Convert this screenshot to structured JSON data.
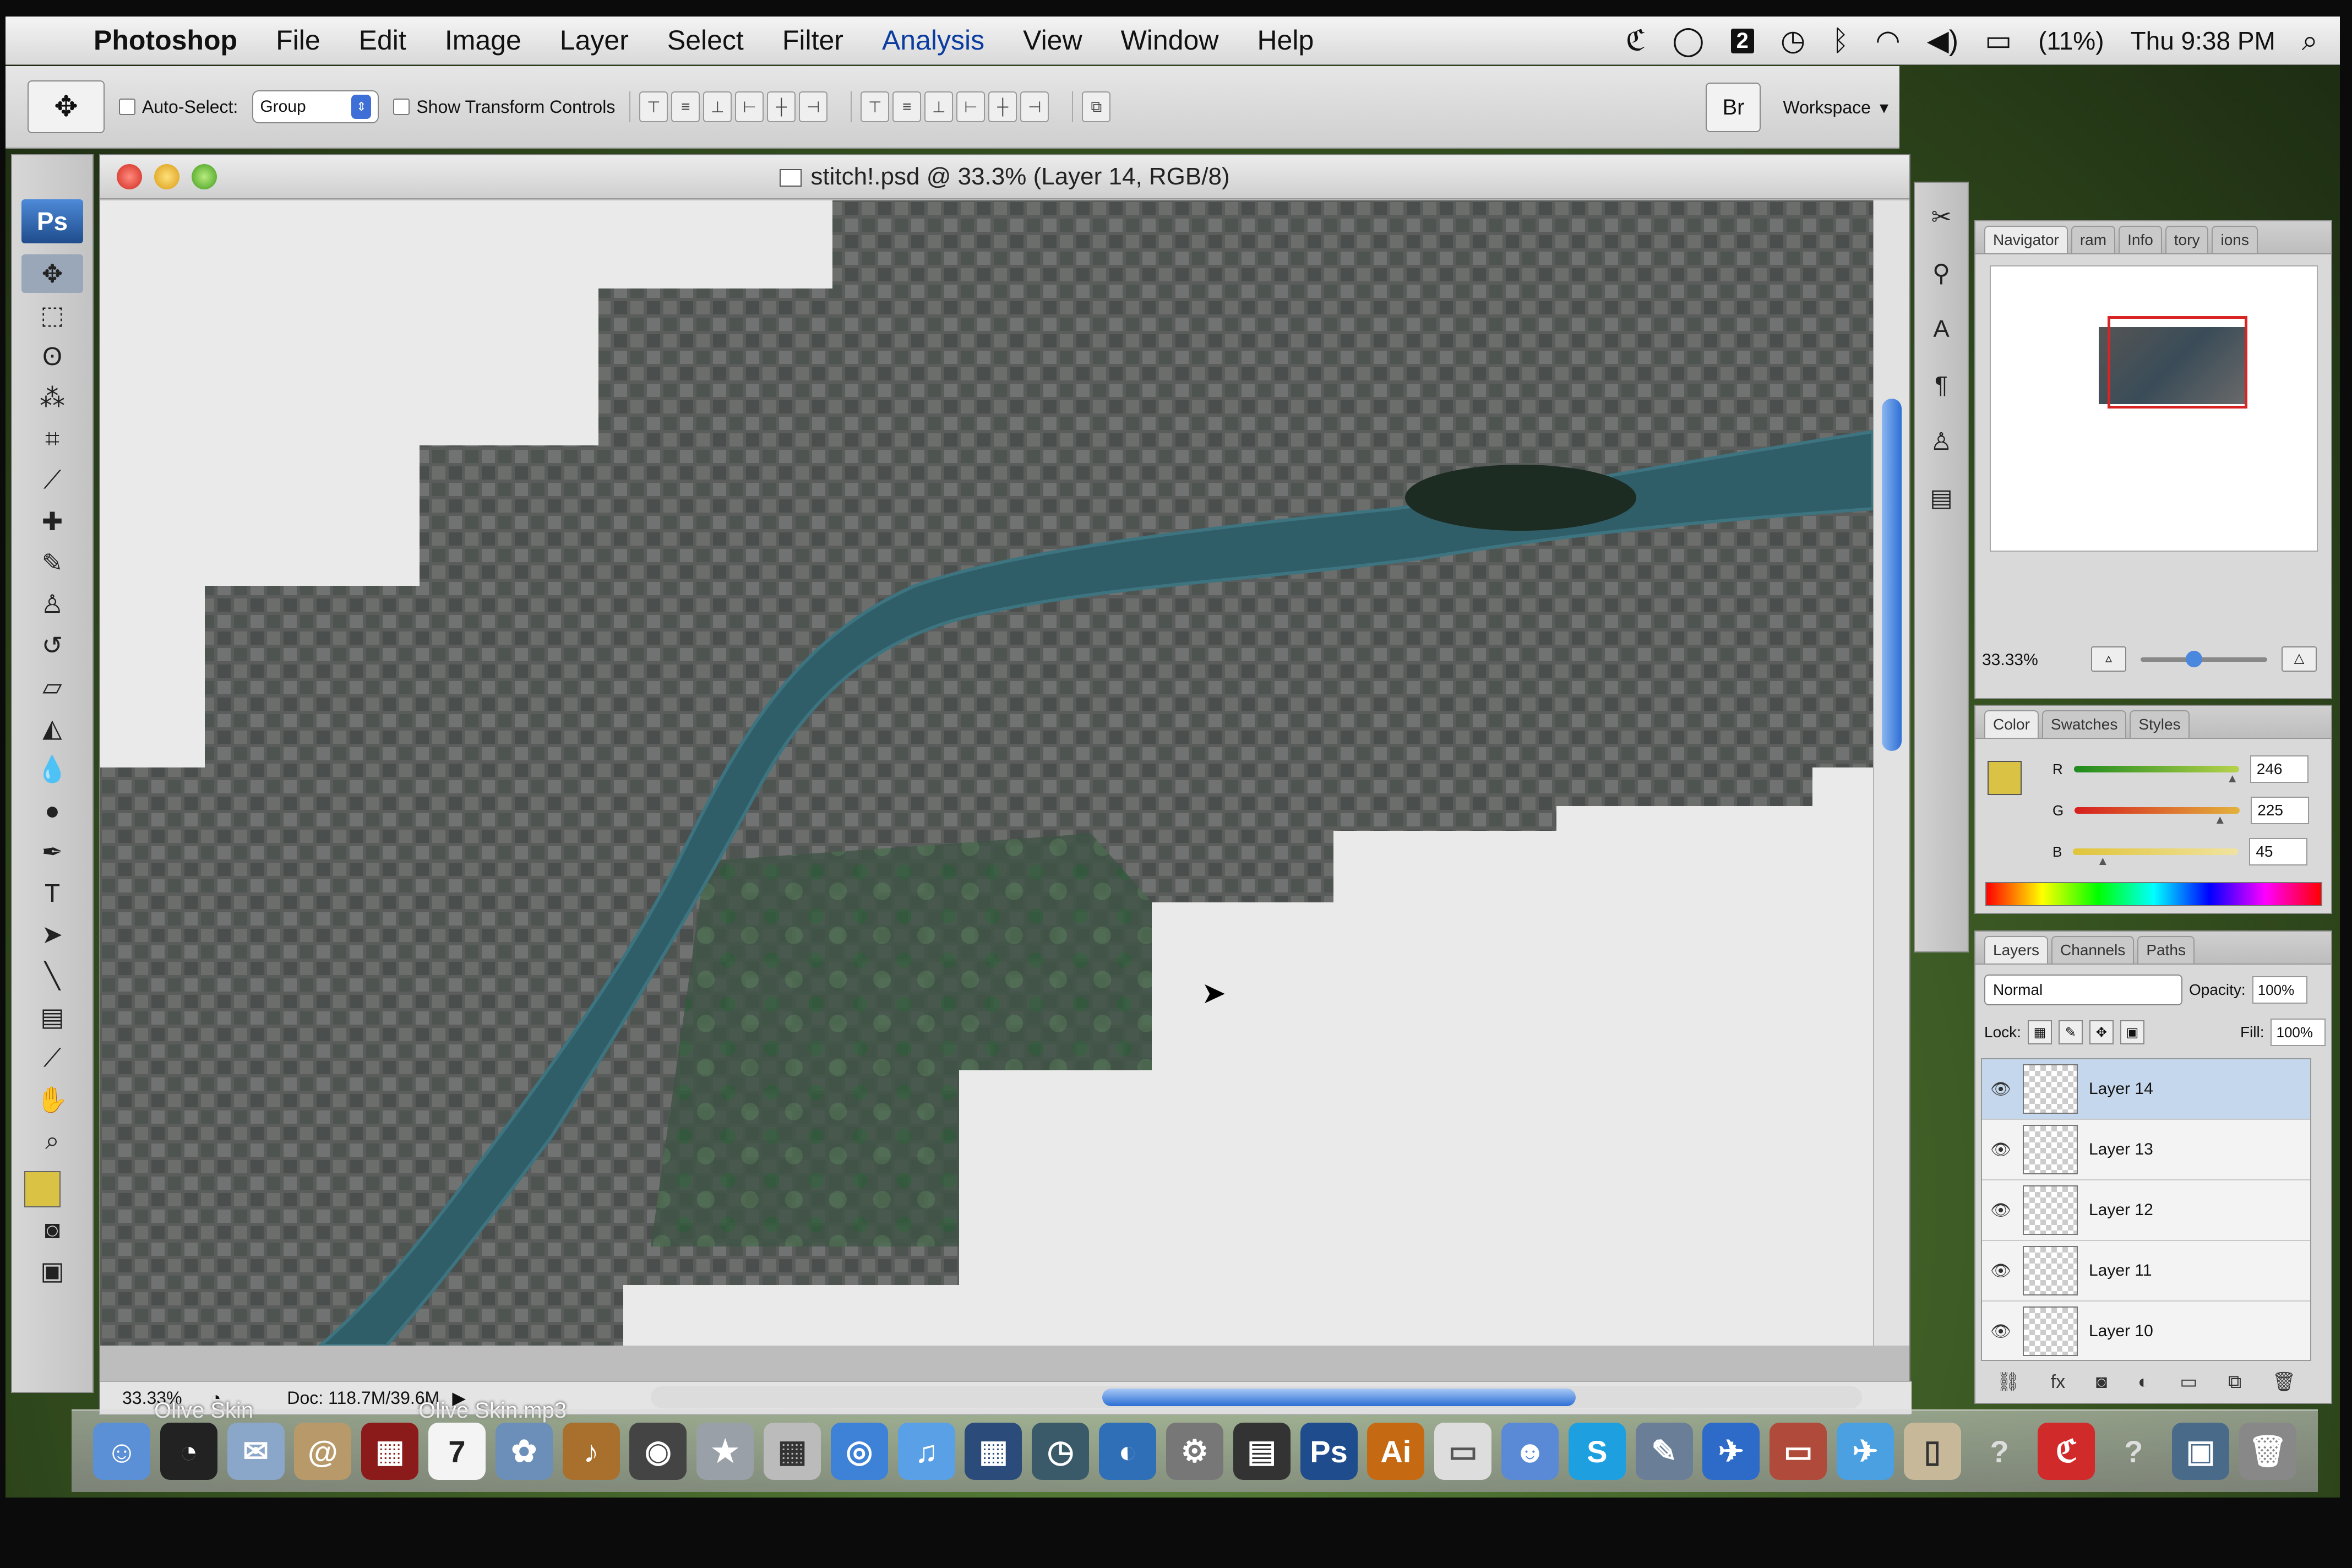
{
  "menubar": {
    "app": "Photoshop",
    "items": [
      "File",
      "Edit",
      "Image",
      "Layer",
      "Select",
      "Filter",
      "Analysis",
      "View",
      "Window",
      "Help"
    ],
    "battery": "(11%)",
    "clock": "Thu 9:38 PM",
    "spaces_number": "2"
  },
  "options": {
    "auto_select_label": "Auto-Select:",
    "auto_select_value": "Group",
    "transform_label": "Show Transform Controls",
    "workspace_label": "Workspace"
  },
  "document": {
    "title": "stitch!.psd @ 33.3% (Layer 14, RGB/8)",
    "zoom": "33.33%",
    "doc_size": "Doc: 118.7M/39.6M"
  },
  "navigator": {
    "tabs": [
      "Navigator",
      "ram",
      "Info",
      "tory",
      "ions"
    ],
    "zoom": "33.33%"
  },
  "color_panel": {
    "tabs": [
      "Color",
      "Swatches",
      "Styles"
    ],
    "r_label": "R",
    "g_label": "G",
    "b_label": "B",
    "r": "246",
    "g": "225",
    "b": "45",
    "r_level": 0.96,
    "g_level": 0.88,
    "b_level": 0.18,
    "foreground_color": "#d9c244"
  },
  "layers_panel": {
    "tabs": [
      "Layers",
      "Channels",
      "Paths"
    ],
    "blend_mode": "Normal",
    "opacity_label": "Opacity:",
    "opacity": "100%",
    "lock_label": "Lock:",
    "fill_label": "Fill:",
    "fill": "100%",
    "layers": [
      "Layer 14",
      "Layer 13",
      "Layer 12",
      "Layer 11",
      "Layer 10"
    ],
    "selected_layer": "Layer 14"
  },
  "dock": {
    "label_left": "Olive Skin",
    "label_right": "Olive Skin.mp3",
    "calendar_day": "7",
    "icons": [
      "finder-icon",
      "dashboard-icon",
      "mail-stamp-icon",
      "address-book-icon",
      "photo-booth-icon",
      "ical-icon",
      "iphoto-icon",
      "garageband-icon",
      "dvd-icon",
      "imovie-star-icon",
      "calculator-icon",
      "safari-icon",
      "itunes-icon",
      "spaces-icon",
      "time-machine-icon",
      "google-earth-icon",
      "system-prefs-icon",
      "clapper-icon",
      "photoshop-icon",
      "illustrator-icon",
      "preview-icon",
      "ichat-icon",
      "skype-icon",
      "xcode-icon",
      "bird-icon",
      "keynote-icon",
      "twitter-bird-icon",
      "document-icon",
      "help-icon",
      "creative-suite-icon",
      "help-icon-2",
      "desktop-icon",
      "trash-icon"
    ],
    "ps_label": "Ps",
    "ai_label": "Ai"
  }
}
